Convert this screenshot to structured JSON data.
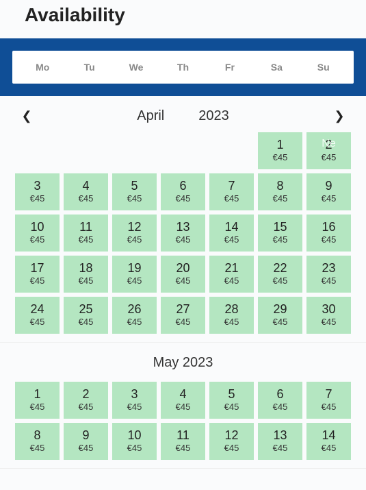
{
  "title": "Availability",
  "weekdays": [
    "Mo",
    "Tu",
    "We",
    "Th",
    "Fr",
    "Sa",
    "Su"
  ],
  "nav_overlay": "Ne",
  "months": [
    {
      "name": "April",
      "year": "2023",
      "label": "April 2023",
      "split": true,
      "nav": true,
      "lead_blanks": 5,
      "days": [
        {
          "n": "1",
          "price": "€45"
        },
        {
          "n": "2",
          "price": "€45",
          "overlay": true
        },
        {
          "n": "3",
          "price": "€45"
        },
        {
          "n": "4",
          "price": "€45"
        },
        {
          "n": "5",
          "price": "€45"
        },
        {
          "n": "6",
          "price": "€45"
        },
        {
          "n": "7",
          "price": "€45"
        },
        {
          "n": "8",
          "price": "€45"
        },
        {
          "n": "9",
          "price": "€45"
        },
        {
          "n": "10",
          "price": "€45"
        },
        {
          "n": "11",
          "price": "€45"
        },
        {
          "n": "12",
          "price": "€45"
        },
        {
          "n": "13",
          "price": "€45"
        },
        {
          "n": "14",
          "price": "€45"
        },
        {
          "n": "15",
          "price": "€45"
        },
        {
          "n": "16",
          "price": "€45"
        },
        {
          "n": "17",
          "price": "€45"
        },
        {
          "n": "18",
          "price": "€45"
        },
        {
          "n": "19",
          "price": "€45"
        },
        {
          "n": "20",
          "price": "€45"
        },
        {
          "n": "21",
          "price": "€45"
        },
        {
          "n": "22",
          "price": "€45"
        },
        {
          "n": "23",
          "price": "€45"
        },
        {
          "n": "24",
          "price": "€45"
        },
        {
          "n": "25",
          "price": "€45"
        },
        {
          "n": "26",
          "price": "€45"
        },
        {
          "n": "27",
          "price": "€45"
        },
        {
          "n": "28",
          "price": "€45"
        },
        {
          "n": "29",
          "price": "€45"
        },
        {
          "n": "30",
          "price": "€45"
        }
      ]
    },
    {
      "name": "May",
      "year": "2023",
      "label": "May 2023",
      "split": false,
      "nav": false,
      "lead_blanks": 0,
      "days": [
        {
          "n": "1",
          "price": "€45"
        },
        {
          "n": "2",
          "price": "€45"
        },
        {
          "n": "3",
          "price": "€45"
        },
        {
          "n": "4",
          "price": "€45"
        },
        {
          "n": "5",
          "price": "€45"
        },
        {
          "n": "6",
          "price": "€45"
        },
        {
          "n": "7",
          "price": "€45"
        },
        {
          "n": "8",
          "price": "€45"
        },
        {
          "n": "9",
          "price": "€45"
        },
        {
          "n": "10",
          "price": "€45"
        },
        {
          "n": "11",
          "price": "€45"
        },
        {
          "n": "12",
          "price": "€45"
        },
        {
          "n": "13",
          "price": "€45"
        },
        {
          "n": "14",
          "price": "€45"
        }
      ]
    }
  ]
}
